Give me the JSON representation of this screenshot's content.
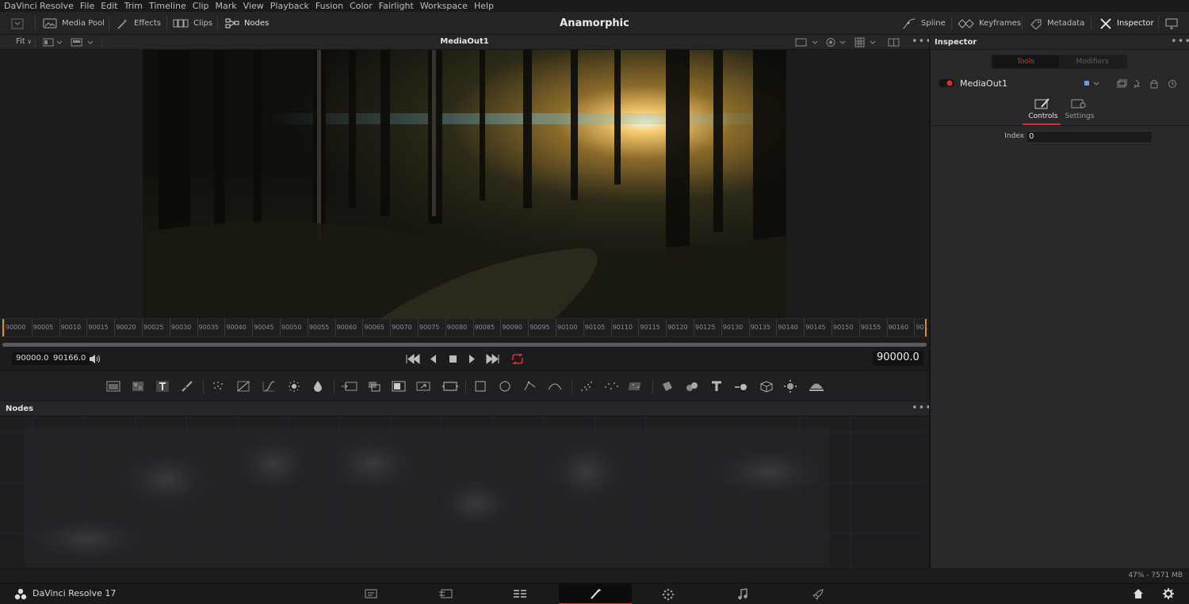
{
  "menu": [
    "DaVinci Resolve",
    "File",
    "Edit",
    "Trim",
    "Timeline",
    "Clip",
    "Mark",
    "View",
    "Playback",
    "Fusion",
    "Color",
    "Fairlight",
    "Workspace",
    "Help"
  ],
  "toolbar": {
    "media_pool": "Media Pool",
    "effects": "Effects",
    "clips": "Clips",
    "nodes": "Nodes",
    "project_title": "Anamorphic",
    "spline": "Spline",
    "keyframes": "Keyframes",
    "metadata": "Metadata",
    "inspector": "Inspector"
  },
  "viewer": {
    "fit": "Fit",
    "title": "MediaOut1"
  },
  "timeline_ruler": [
    "90000",
    "90005",
    "90010",
    "90015",
    "90020",
    "90025",
    "90030",
    "90035",
    "90040",
    "90045",
    "90050",
    "90055",
    "90060",
    "90065",
    "90070",
    "90075",
    "90080",
    "90085",
    "90090",
    "90095",
    "90100",
    "90105",
    "90110",
    "90115",
    "90120",
    "90125",
    "90130",
    "90135",
    "90140",
    "90145",
    "90150",
    "90155",
    "90160",
    "901"
  ],
  "transport": {
    "start_tc": "90000.0",
    "end_tc": "90166.0",
    "current_tc": "90000.0"
  },
  "nodes_panel": {
    "title": "Nodes"
  },
  "inspector": {
    "title": "Inspector",
    "tab_tools": "Tools",
    "tab_modifiers": "Modifiers",
    "node_name": "MediaOut1",
    "subtab_controls": "Controls",
    "subtab_settings": "Settings",
    "index_label": "Index",
    "index_value": "0"
  },
  "status": {
    "memory": "47% - 7571 MB"
  },
  "footer": {
    "app_name": "DaVinci Resolve 17"
  },
  "colors": {
    "accent_red": "#d8322f",
    "orange_marker": "#e0902a",
    "background": "#1c1c1f"
  }
}
